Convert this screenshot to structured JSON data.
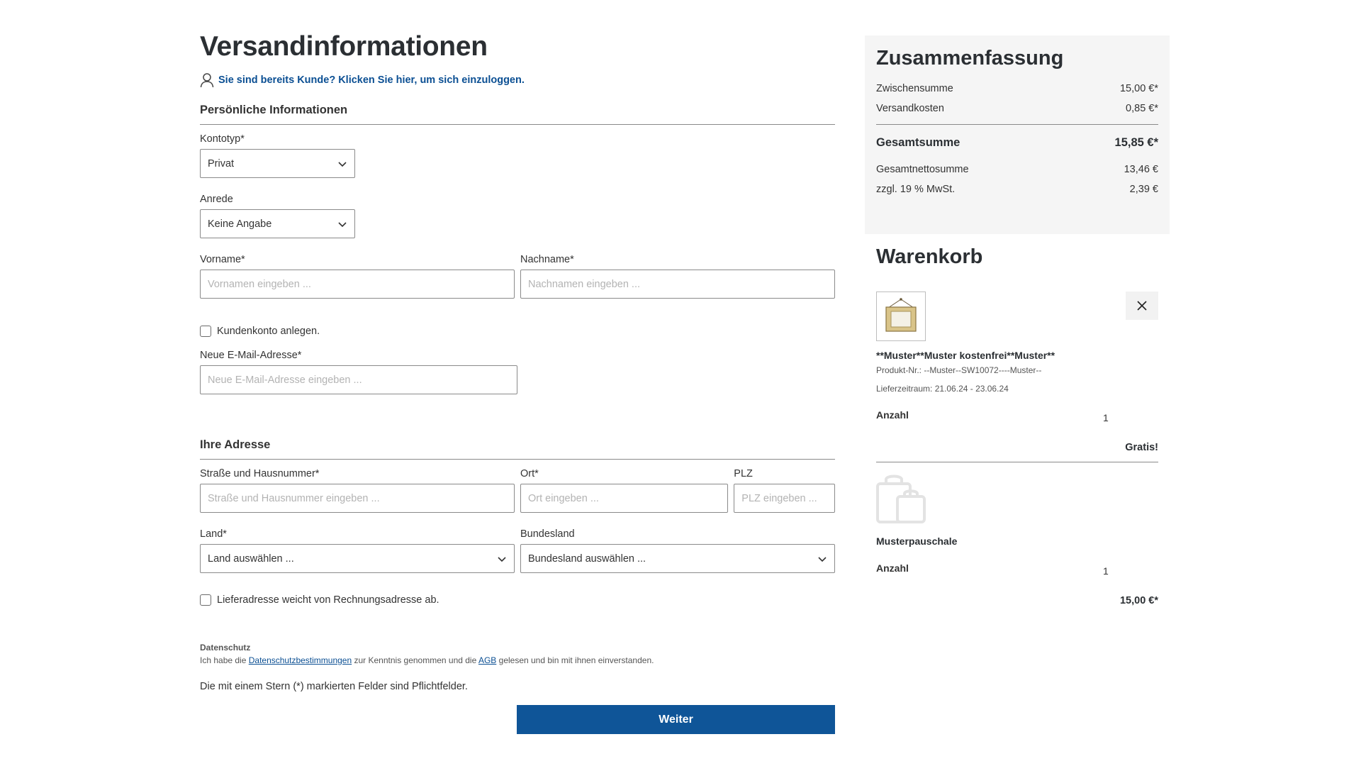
{
  "page": {
    "title": "Versandinformationen",
    "login_link": "Sie sind bereits Kunde? Klicken Sie hier, um sich einzuloggen."
  },
  "personal": {
    "section_title": "Persönliche Informationen",
    "account_type_label": "Kontotyp*",
    "account_type_value": "Privat",
    "salutation_label": "Anrede",
    "salutation_value": "Keine Angabe",
    "firstname_label": "Vorname*",
    "firstname_placeholder": "Vornamen eingeben ...",
    "lastname_label": "Nachname*",
    "lastname_placeholder": "Nachnamen eingeben ...",
    "create_account_label": "Kundenkonto anlegen.",
    "email_label": "Neue E-Mail-Adresse*",
    "email_placeholder": "Neue E-Mail-Adresse eingeben ..."
  },
  "address": {
    "section_title": "Ihre Adresse",
    "street_label": "Straße und Hausnummer*",
    "street_placeholder": "Straße und Hausnummer eingeben ...",
    "city_label": "Ort*",
    "city_placeholder": "Ort eingeben ...",
    "zip_label": "PLZ",
    "zip_placeholder": "PLZ eingeben ...",
    "country_label": "Land*",
    "country_value": "Land auswählen ...",
    "state_label": "Bundesland",
    "state_value": "Bundesland auswählen ...",
    "different_shipping_label": "Lieferadresse weicht von Rechnungsadresse ab."
  },
  "privacy": {
    "title": "Datenschutz",
    "text_1": "Ich habe die",
    "link_privacy": "Datenschutzbestimmungen",
    "text_2": "zur Kenntnis genommen und die",
    "link_agb": "AGB",
    "text_3": "gelesen und bin mit ihnen einverstanden."
  },
  "required_note": "Die mit einem Stern (*) markierten Felder sind Pflichtfelder.",
  "submit_label": "Weiter",
  "summary": {
    "title": "Zusammenfassung",
    "subtotal_label": "Zwischensumme",
    "subtotal_value": "15,00 €*",
    "shipping_label": "Versandkosten",
    "shipping_value": "0,85 €*",
    "total_label": "Gesamtsumme",
    "total_value": "15,85 €*",
    "net_label": "Gesamtnettosumme",
    "net_value": "13,46 €",
    "vat_label": "zzgl. 19 % MwSt.",
    "vat_value": "2,39 €"
  },
  "cart": {
    "title": "Warenkorb",
    "items": [
      {
        "name": "**Muster**Muster kostenfrei**Muster**",
        "product_no": "Produkt-Nr.: --Muster--SW10072----Muster--",
        "delivery": "Lieferzeitraum: 21.06.24 - 23.06.24",
        "qty_label": "Anzahl",
        "qty": "1",
        "price": "Gratis!"
      },
      {
        "name": "Musterpauschale",
        "qty_label": "Anzahl",
        "qty": "1",
        "price": "15,00 €*"
      }
    ]
  },
  "colors": {
    "primary": "#0f5598",
    "link": "#0b4f93",
    "summary_bg": "#f5f5f5"
  }
}
